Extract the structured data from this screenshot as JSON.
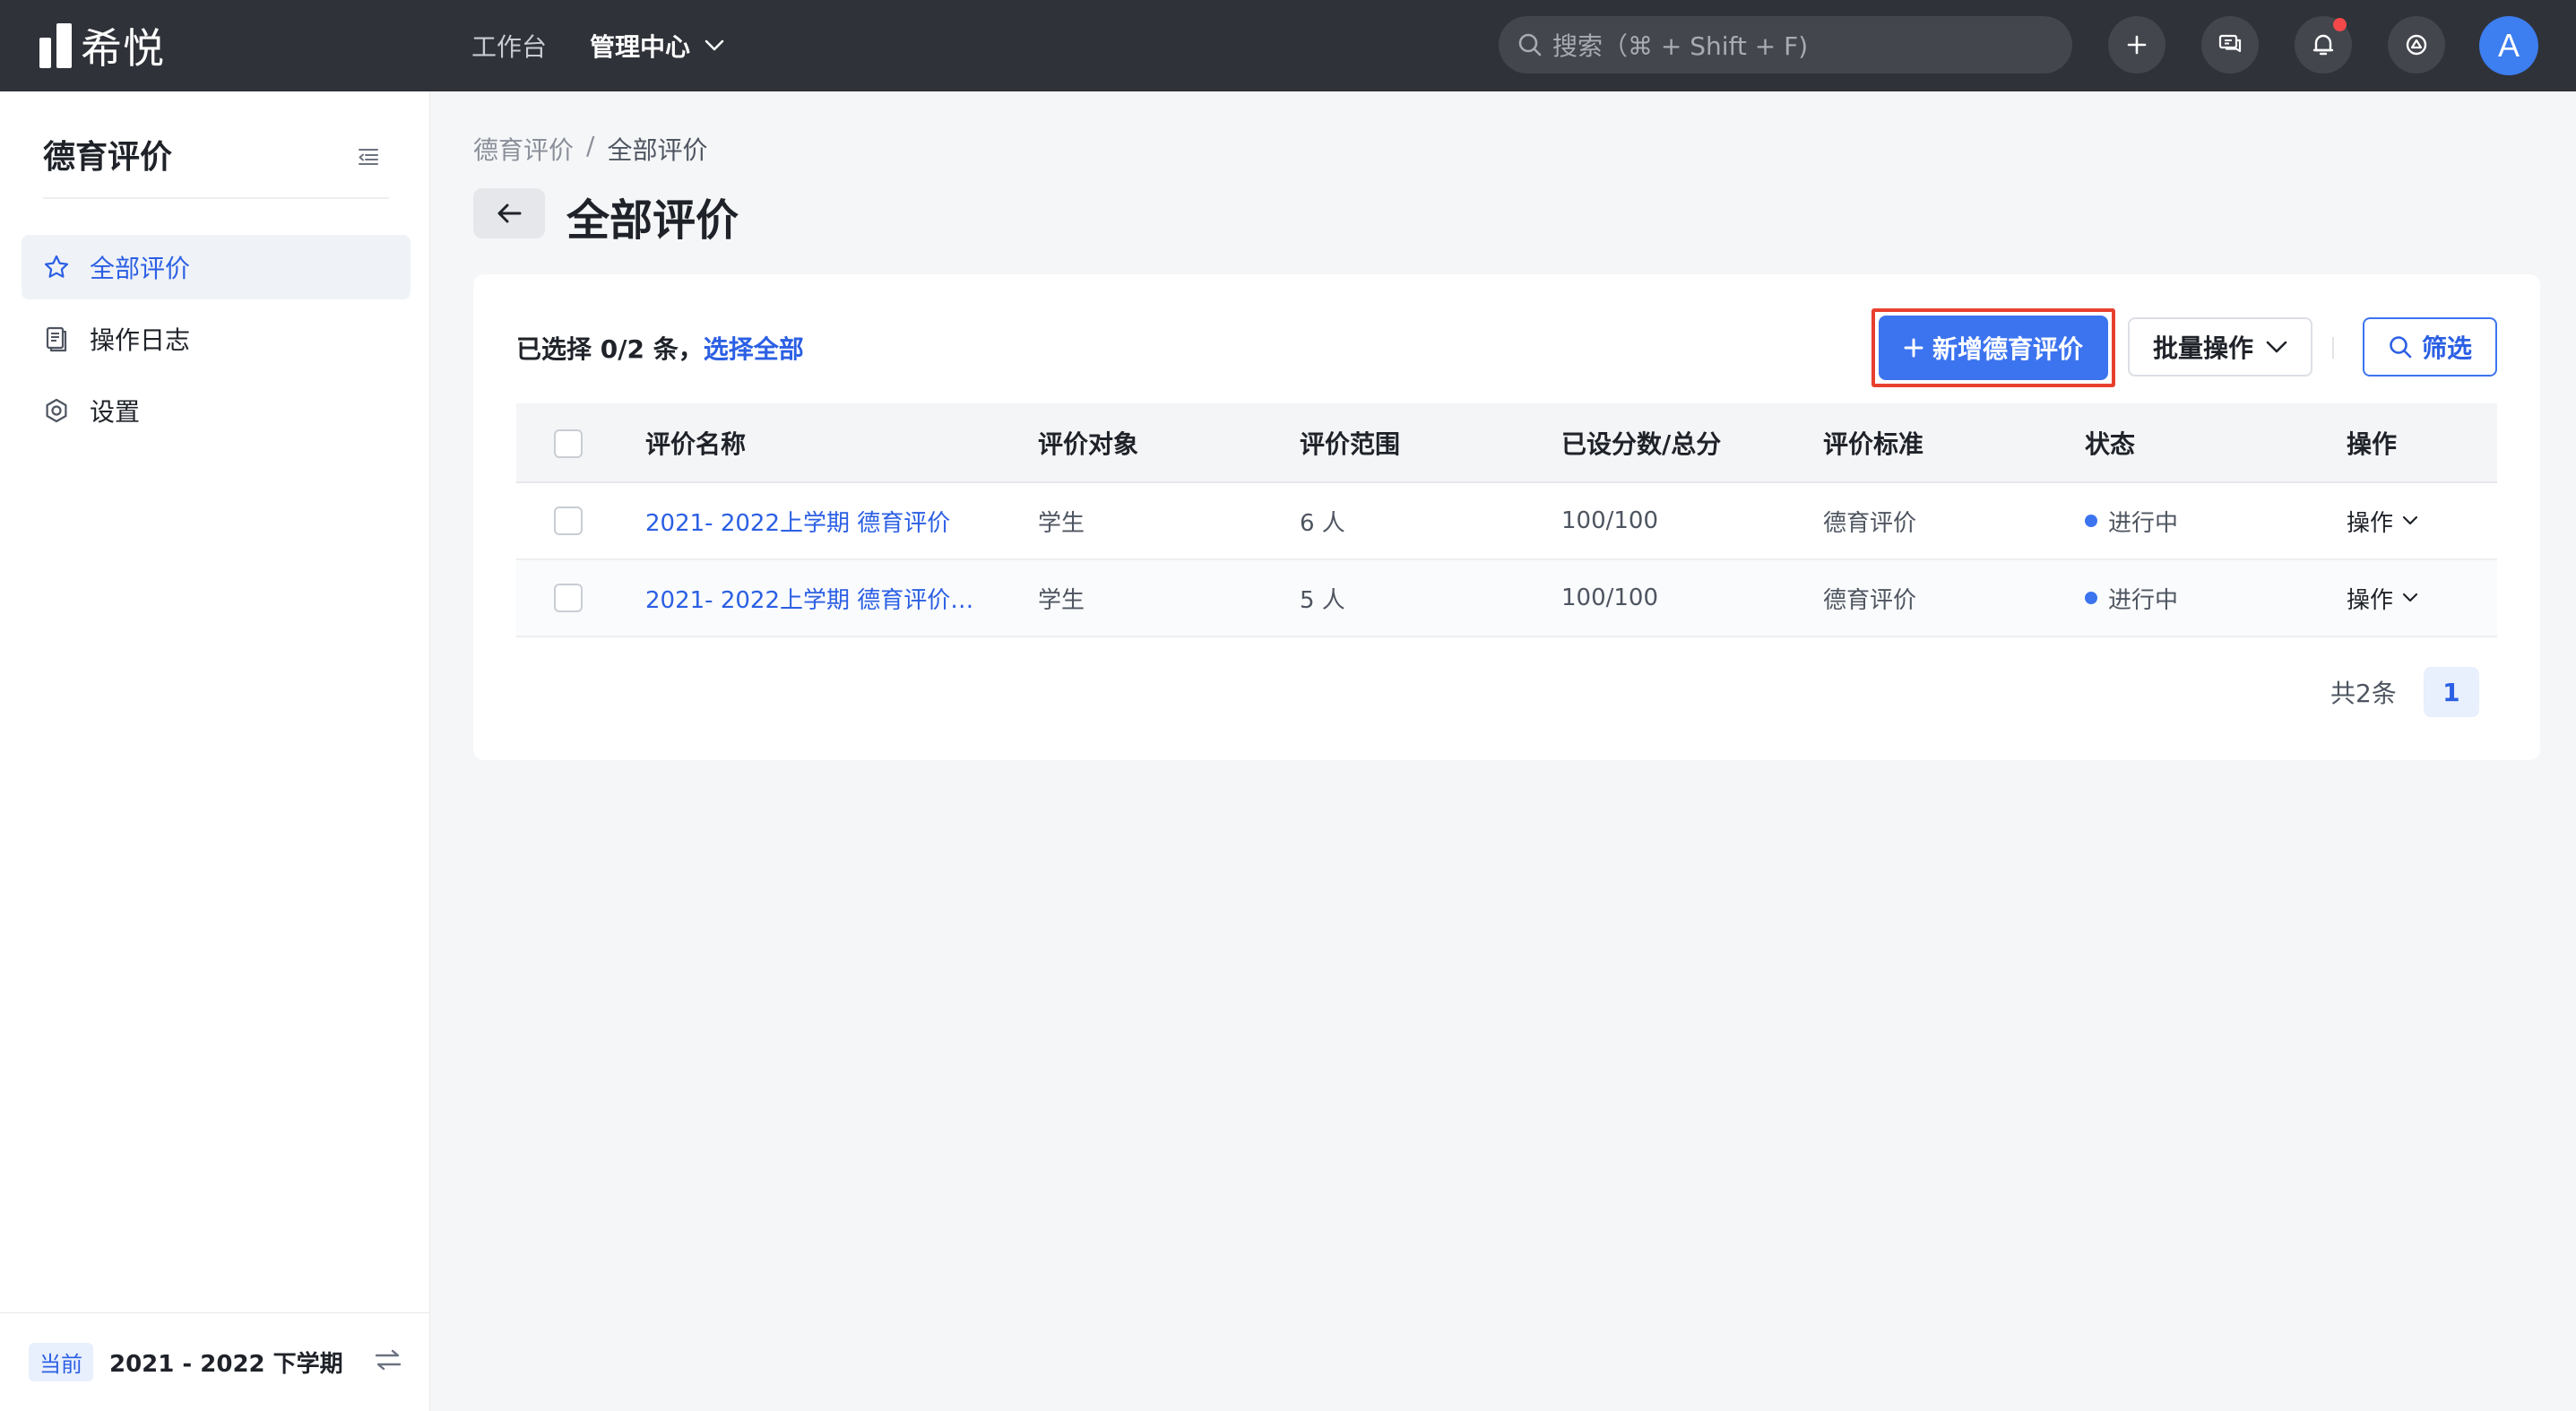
{
  "app": {
    "logo_text": "希悦"
  },
  "topnav": {
    "items": [
      {
        "label": "工作台"
      },
      {
        "label": "管理中心"
      }
    ]
  },
  "search": {
    "placeholder": "搜索（⌘ + Shift + F)"
  },
  "user": {
    "avatar_letter": "A"
  },
  "sidebar": {
    "title": "德育评价",
    "items": [
      {
        "label": "全部评价",
        "icon": "star-icon",
        "active": true
      },
      {
        "label": "操作日志",
        "icon": "log-icon",
        "active": false
      },
      {
        "label": "设置",
        "icon": "gear-icon",
        "active": false
      }
    ],
    "footer": {
      "badge": "当前",
      "term": "2021 - 2022 下学期"
    }
  },
  "breadcrumb": {
    "parent": "德育评价",
    "separator": "/",
    "current": "全部评价"
  },
  "page": {
    "title": "全部评价"
  },
  "toolbar": {
    "selection_text": "已选择 0/2 条，",
    "select_all": "选择全部",
    "add_label": "新增德育评价",
    "batch_label": "批量操作",
    "filter_label": "筛选"
  },
  "table": {
    "headers": [
      "评价名称",
      "评价对象",
      "评价范围",
      "已设分数/总分",
      "评价标准",
      "状态",
      "操作"
    ],
    "rows": [
      {
        "name": "2021- 2022上学期 德育评价",
        "target": "学生",
        "scope": "6 人",
        "score": "100/100",
        "standard": "德育评价",
        "status": "进行中",
        "action": "操作"
      },
      {
        "name": "2021- 2022上学期 德育评价…",
        "target": "学生",
        "scope": "5 人",
        "score": "100/100",
        "standard": "德育评价",
        "status": "进行中",
        "action": "操作"
      }
    ]
  },
  "pagination": {
    "total_text": "共2条",
    "current_page": "1"
  },
  "colors": {
    "topbar": "#2f3238",
    "accent": "#3c74f0",
    "link": "#2b5fe4",
    "highlight_border": "#e8402f",
    "notification_dot": "#f5484b"
  }
}
